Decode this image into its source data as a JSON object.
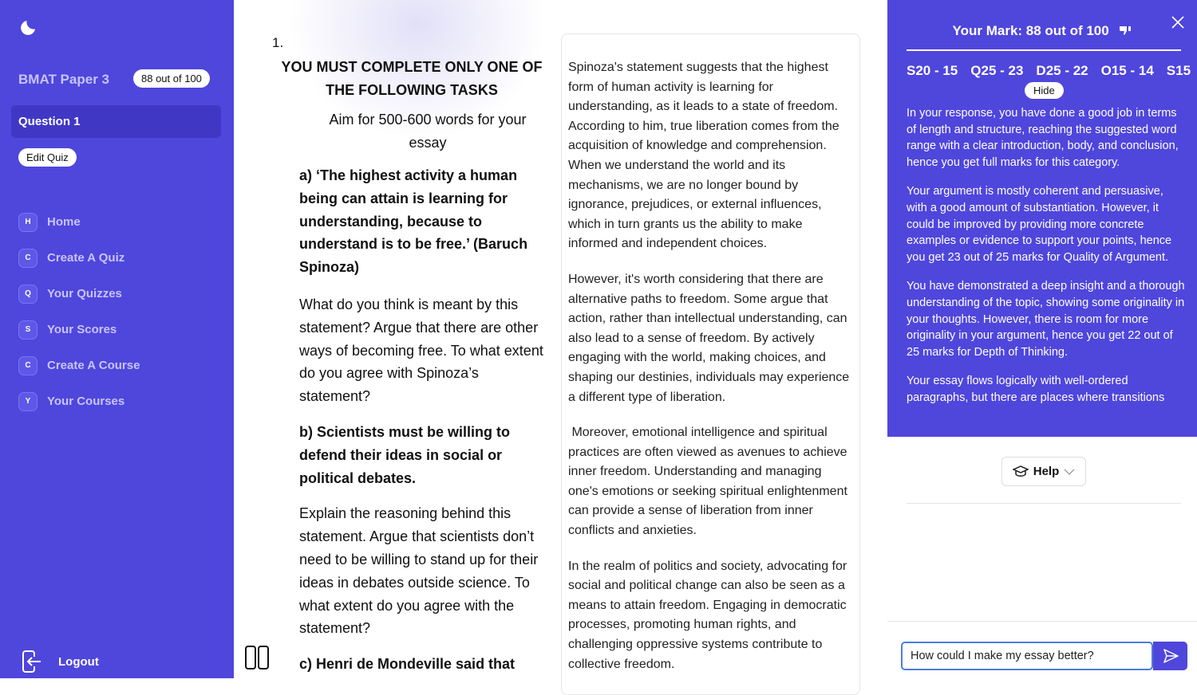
{
  "sidebar": {
    "quiz_title": "BMAT Paper 3",
    "score": "88 out of 100",
    "question": "Question 1",
    "edit_quiz": "Edit Quiz",
    "nav": [
      {
        "badge": "H",
        "label": "Home"
      },
      {
        "badge": "C",
        "label": "Create A Quiz"
      },
      {
        "badge": "Q",
        "label": "Your Quizzes"
      },
      {
        "badge": "S",
        "label": "Your Scores"
      },
      {
        "badge": "C",
        "label": "Create A Course"
      },
      {
        "badge": "Y",
        "label": "Your Courses"
      }
    ],
    "logout": "Logout"
  },
  "question": {
    "number": "1.",
    "heading": "YOU MUST COMPLETE ONLY ONE OF THE FOLLOWING TASKS",
    "aim": "Aim for 500-600 words for your essay",
    "sections": [
      "a) ‘The highest activity a human being can attain is learning for understanding, because to understand is to be free.’ (Baruch Spinoza)",
      "What do you think is meant by this statement? Argue that there are other ways of becoming free. To what extent do you agree with Spinoza’s statement?",
      "b) Scientists must be willing to defend their ideas in social or political debates.",
      "Explain the reasoning behind this statement. Argue that scientists don’t need to be willing to stand up for their ideas in debates outside science. To what extent do you agree with the statement?",
      "c) Henri de Mondeville said that"
    ]
  },
  "essay": [
    "Spinoza's statement suggests that the highest form of human activity is learning for understanding, as it leads to a state of freedom. According to him, true liberation comes from the acquisition of knowledge and comprehension. When we understand the world and its mechanisms, we are no longer bound by ignorance, prejudices, or external influences, which in turn grants us the ability to make informed and independent choices.",
    "However, it's worth considering that there are alternative paths to freedom. Some argue that action, rather than intellectual understanding, can also lead to a sense of freedom. By actively engaging with the world, making choices, and shaping our destinies, individuals may experience a different type of liberation.",
    " Moreover, emotional intelligence and spiritual practices are often viewed as avenues to achieve inner freedom. Understanding and managing one's emotions or seeking spiritual enlightenment can provide a sense of liberation from inner conflicts and anxieties.",
    "In the realm of politics and society, advocating for social and political change can also be seen as a means to attain freedom. Engaging in democratic processes, promoting human rights, and challenging oppressive systems contribute to collective freedom."
  ],
  "feedback": {
    "mark": "Your Mark: 88 out of 100",
    "categories": [
      "S20 - 15",
      "Q25 - 23",
      "D25 - 22",
      "O15 - 14",
      "S15"
    ],
    "hide": "Hide",
    "paragraphs": [
      "In your response, you have done a good job in terms of length and structure, reaching the suggested word range with a clear introduction, body, and conclusion, hence you get full marks for this category.",
      "Your argument is mostly coherent and persuasive, with a good amount of substantiation. However, it could be improved by providing more concrete examples or evidence to support your points, hence you get 23 out of 25 marks for Quality of Argument.",
      "You have demonstrated a deep insight and a thorough understanding of the topic, showing some originality in your thoughts. However, there is room for more originality in your argument, hence you get 22 out of 25 marks for Depth of Thinking.",
      "Your essay flows logically with well-ordered paragraphs, but there are places where transitions"
    ]
  },
  "chat": {
    "help": "Help",
    "input": "How could I make my essay better?"
  },
  "colors": {
    "accent": "#4f46dc",
    "input_border": "#4a7de0"
  }
}
